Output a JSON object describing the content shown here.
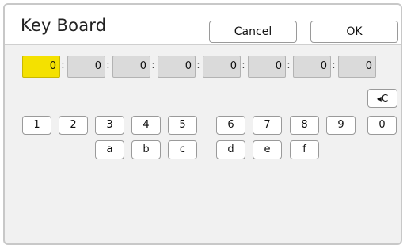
{
  "header": {
    "title": "Key Board",
    "cancel_label": "Cancel",
    "ok_label": "OK"
  },
  "address": {
    "fields": [
      "0",
      "0",
      "0",
      "0",
      "0",
      "0",
      "0",
      "0"
    ],
    "separator": ":",
    "active_index": 0
  },
  "keypad": {
    "backspace_label": "◂C",
    "row1": [
      "1",
      "2",
      "3",
      "4",
      "5",
      "6",
      "7",
      "8",
      "9",
      "0"
    ],
    "row2": [
      "a",
      "b",
      "c",
      "d",
      "e",
      "f"
    ]
  },
  "colors": {
    "active_field": "#f4e100",
    "field": "#dadada",
    "panel": "#f1f1f1"
  }
}
